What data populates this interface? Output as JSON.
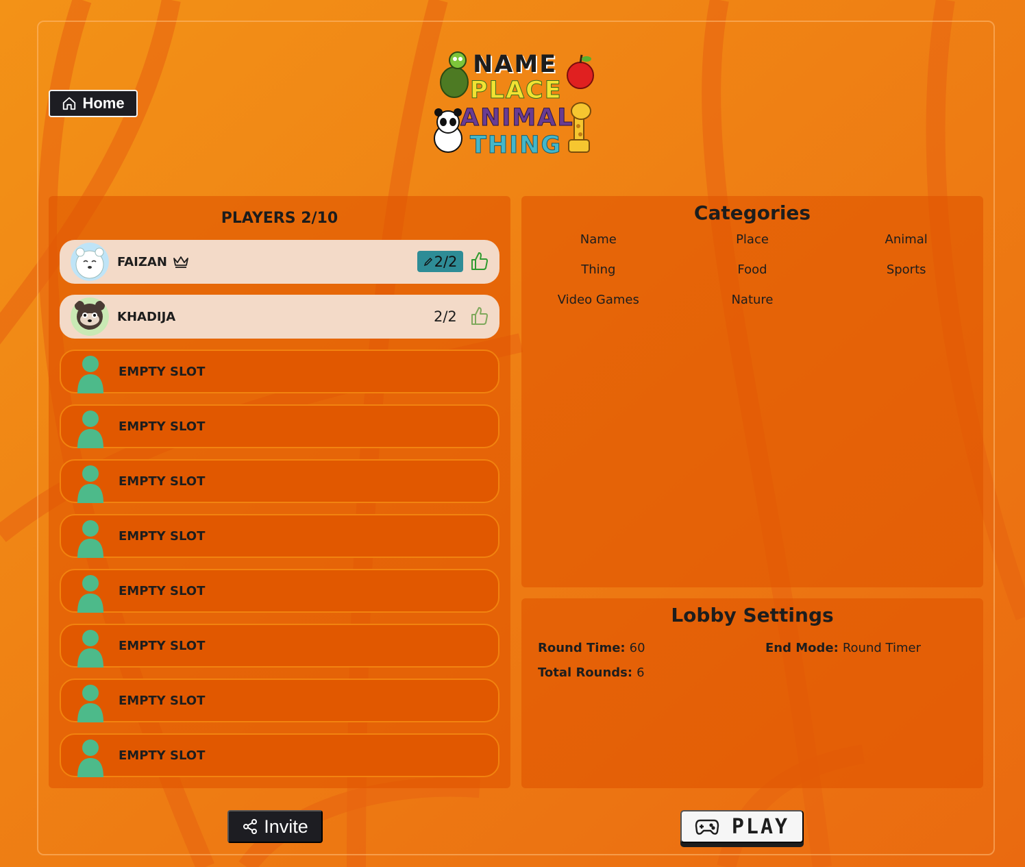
{
  "nav": {
    "home_label": "Home"
  },
  "logo": {
    "line1": "NAME",
    "line2": "PLACE",
    "line3": "ANIMAL",
    "line4": "THING"
  },
  "players": {
    "title": "PLAYERS 2/10",
    "filled": [
      {
        "name": "FAIZAN",
        "host": true,
        "score": "2/2",
        "editable": true,
        "avatar": "polar-bear-avatar"
      },
      {
        "name": "KHADIJA",
        "host": false,
        "score": "2/2",
        "editable": false,
        "avatar": "raccoon-avatar"
      }
    ],
    "empty_label": "EMPTY SLOT",
    "empty_count": 8
  },
  "categories": {
    "title": "Categories",
    "items": [
      "Name",
      "Place",
      "Animal",
      "Thing",
      "Food",
      "Sports",
      "Video Games",
      "Nature"
    ]
  },
  "lobby": {
    "title": "Lobby Settings",
    "round_time_label": "Round Time:",
    "round_time_value": "60",
    "end_mode_label": "End Mode:",
    "end_mode_value": "Round Timer",
    "total_rounds_label": "Total Rounds:",
    "total_rounds_value": "6"
  },
  "actions": {
    "invite_label": "Invite",
    "play_label": "PLAY"
  },
  "colors": {
    "background": "#ee7a12",
    "panel": "#e05400",
    "badge": "#2e8c96",
    "avatar_empty": "#4dba8a",
    "dark_button": "#1d1d22"
  }
}
